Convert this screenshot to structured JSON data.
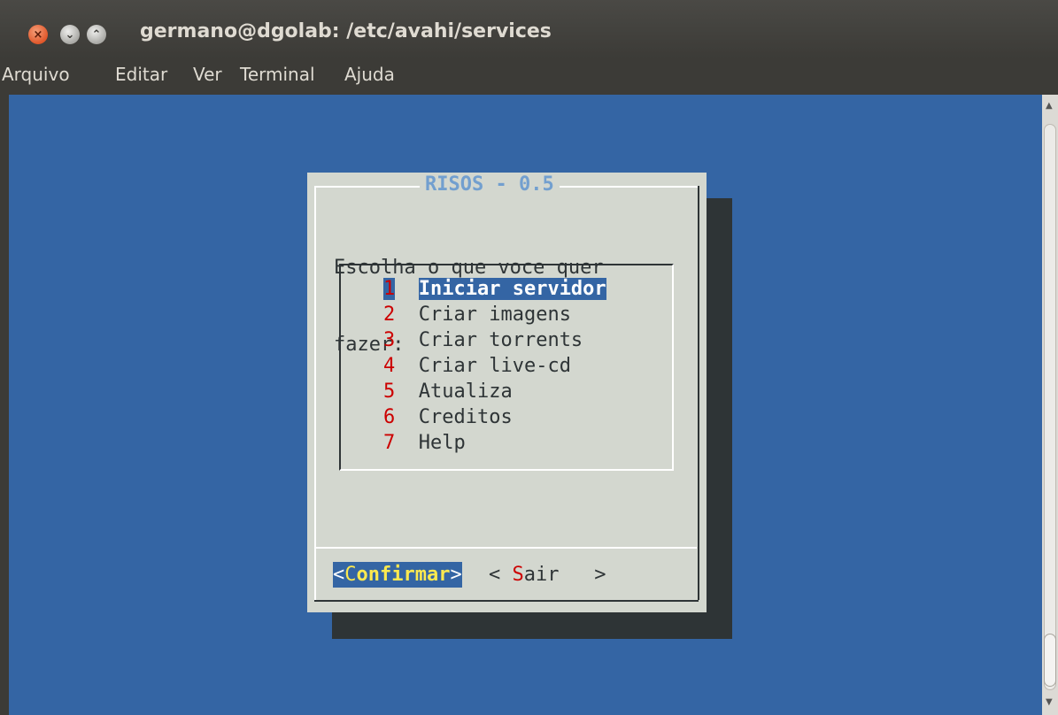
{
  "window": {
    "title": "germano@dgolab: /etc/avahi/services",
    "close_glyph": "×",
    "minimize_glyph": "⌄",
    "maximize_glyph": "⌃"
  },
  "menu": {
    "items": [
      "Arquivo",
      "Editar",
      "Ver",
      "Terminal",
      "Ajuda"
    ]
  },
  "dialog": {
    "title": "RISOS - 0.5",
    "prompt_line1": "Escolha o que voce quer",
    "prompt_line2": "fazer:",
    "items": [
      {
        "num": "1",
        "label": "Iniciar servidor",
        "selected": true
      },
      {
        "num": "2",
        "label": "Criar imagens"
      },
      {
        "num": "3",
        "label": "Criar torrents"
      },
      {
        "num": "4",
        "label": "Criar live-cd"
      },
      {
        "num": "5",
        "label": "Atualiza"
      },
      {
        "num": "6",
        "label": "Creditos"
      },
      {
        "num": "7",
        "label": "Help"
      }
    ],
    "buttons": {
      "confirm": {
        "open": "<",
        "hot": "C",
        "rest": "onfirmar",
        "close": ">"
      },
      "quit": {
        "open": "< ",
        "hot": "S",
        "rest": "air",
        "close": "   >"
      }
    }
  },
  "scrollbar": {
    "up_glyph": "▲",
    "down_glyph": "▼"
  },
  "colors": {
    "terminal_bg": "#3465a4",
    "dialog_bg": "#d3d7cf",
    "hotkey": "#cc0000",
    "title": "#729fcf",
    "highlight_text": "#fce94f"
  }
}
